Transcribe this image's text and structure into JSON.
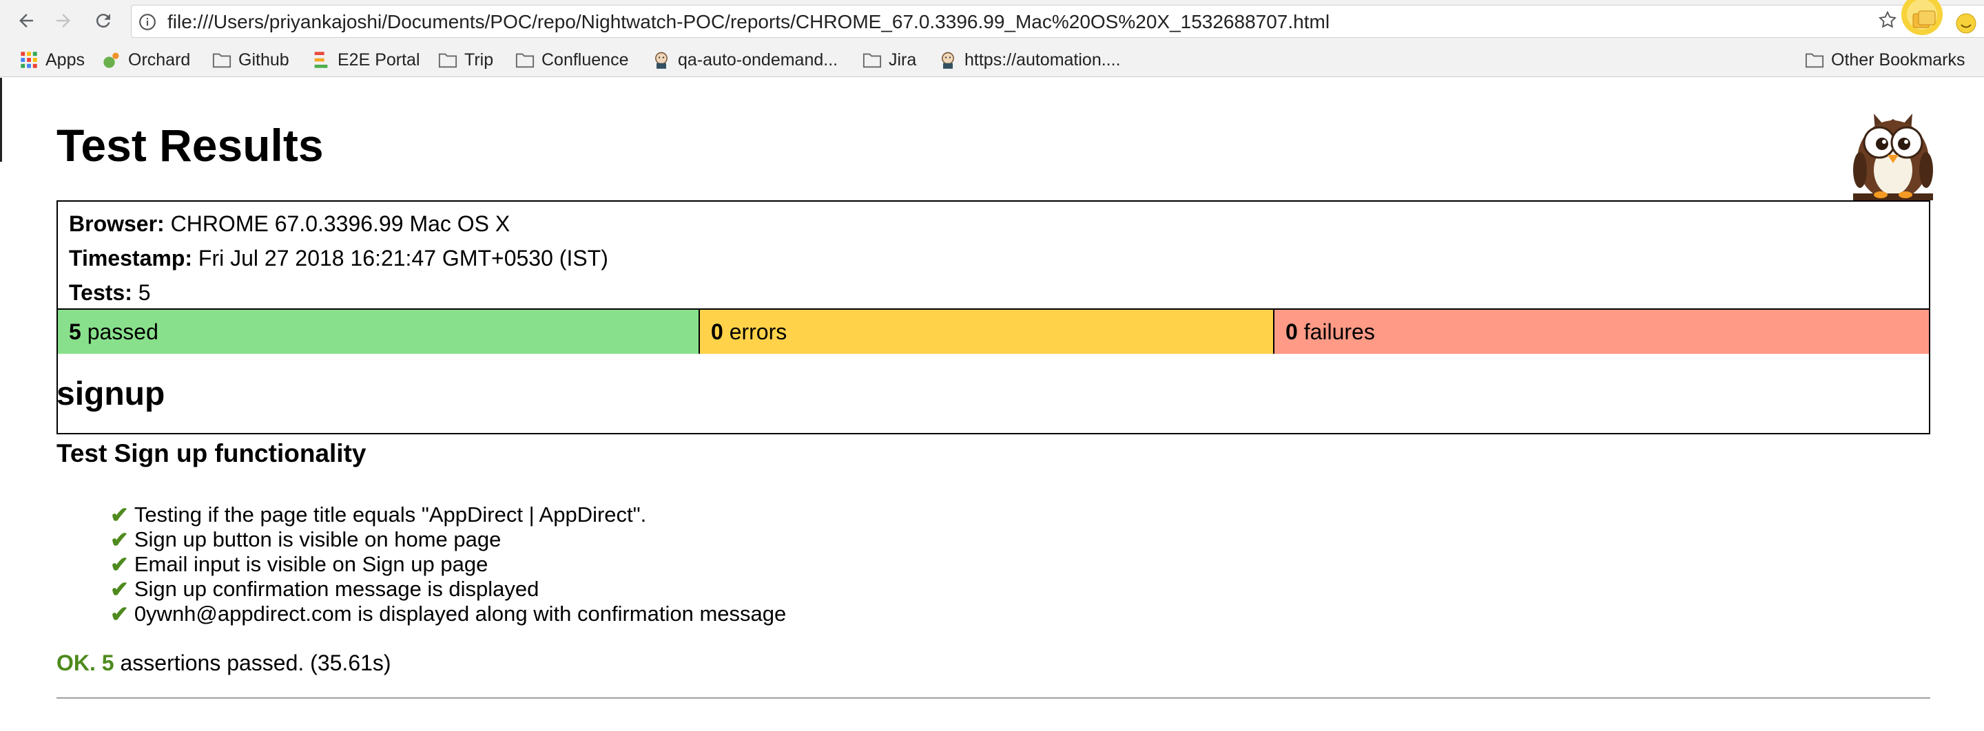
{
  "browser": {
    "url": "file:///Users/priyankajoshi/Documents/POC/repo/Nightwatch-POC/reports/CHROME_67.0.3396.99_Mac%20OS%20X_1532688707.html",
    "bookmarks": [
      {
        "label": "Apps",
        "icon": "apps-grid-icon"
      },
      {
        "label": "Orchard",
        "icon": "orchard-icon"
      },
      {
        "label": "Github",
        "icon": "folder-icon"
      },
      {
        "label": "E2E Portal",
        "icon": "e2e-portal-icon"
      },
      {
        "label": "Trip",
        "icon": "folder-icon"
      },
      {
        "label": "Confluence",
        "icon": "folder-icon"
      },
      {
        "label": "qa-auto-ondemand...",
        "icon": "jenkins-icon"
      },
      {
        "label": "Jira",
        "icon": "folder-icon"
      },
      {
        "label": "https://automation....",
        "icon": "jenkins-icon"
      },
      {
        "label": "Other Bookmarks",
        "icon": "folder-icon"
      }
    ]
  },
  "report": {
    "title": "Test Results",
    "browser_label": "Browser:",
    "browser_value": "CHROME 67.0.3396.99 Mac OS X",
    "timestamp_label": "Timestamp:",
    "timestamp_value": "Fri Jul 27 2018 16:21:47 GMT+0530 (IST)",
    "tests_label": "Tests:",
    "tests_value": "5",
    "passed_count": "5",
    "passed_label": "passed",
    "errors_count": "0",
    "errors_label": "errors",
    "failures_count": "0",
    "failures_label": "failures",
    "colors": {
      "passed": "#89e08c",
      "errors": "#ffd24a",
      "failures": "#ff9a86",
      "ok": "#4e8a1e"
    }
  },
  "module": {
    "name": "signup",
    "test_name": "Test Sign up functionality",
    "check_mark": "✔",
    "assertions": [
      "Testing if the page title equals \"AppDirect | AppDirect\".",
      "Sign up button is visible on home page",
      "Email input is visible on Sign up page",
      "Sign up confirmation message is displayed",
      "0ywnh@appdirect.com is displayed along with confirmation message"
    ],
    "result_ok": "OK.",
    "result_count": "5",
    "result_text": "assertions passed. (35.61s)"
  }
}
